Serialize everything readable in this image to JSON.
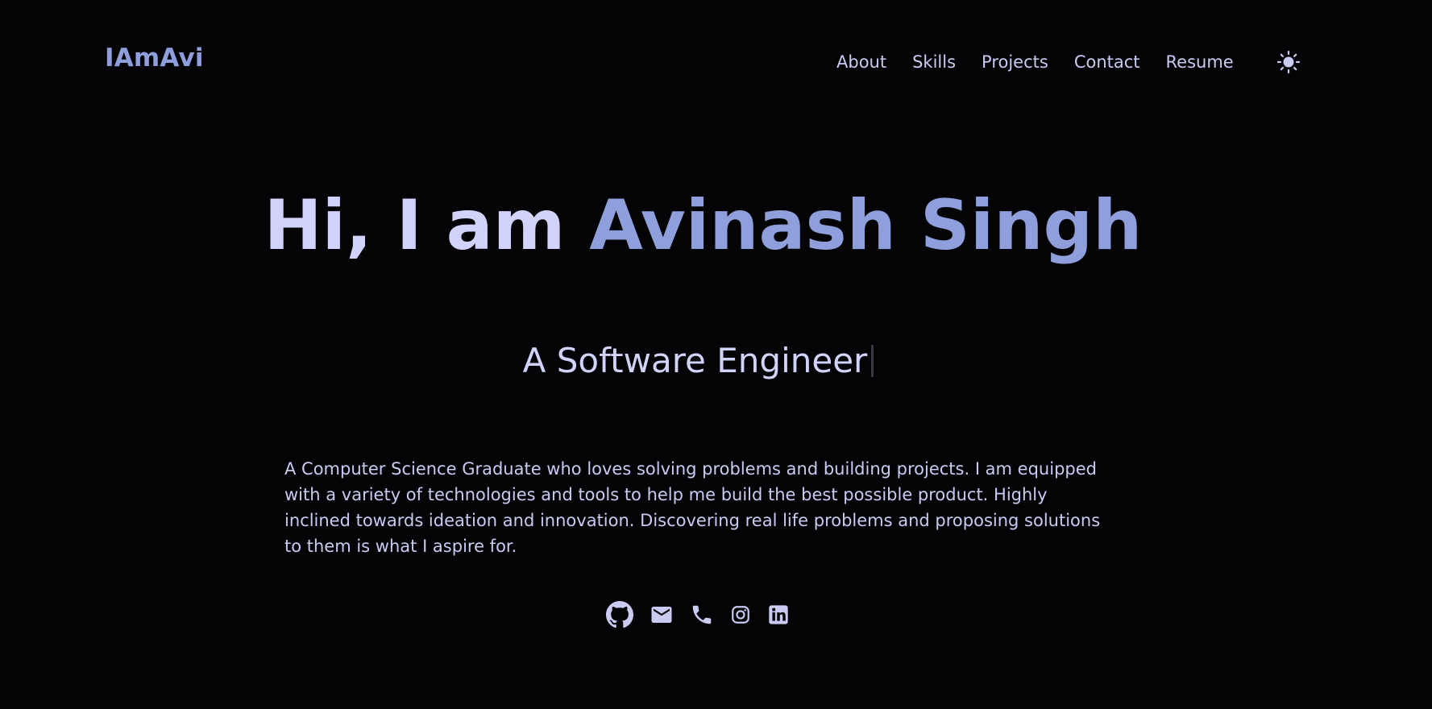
{
  "header": {
    "logo": "IAmAvi",
    "nav": [
      {
        "label": "About"
      },
      {
        "label": "Skills"
      },
      {
        "label": "Projects"
      },
      {
        "label": "Contact"
      },
      {
        "label": "Resume"
      }
    ],
    "theme_toggle_icon": "sun-icon"
  },
  "hero": {
    "greeting": "Hi, I am ",
    "name": "Avinash Singh",
    "subtitle": "A Software Engineer",
    "bio": "A Computer Science Graduate who loves solving problems and building projects. I am equipped with a variety of technologies and tools to help me build the best possible product. Highly inclined towards ideation and innovation. Discovering real life problems and proposing solutions to them is what I aspire for."
  },
  "socials": [
    {
      "icon": "github-icon"
    },
    {
      "icon": "mail-icon"
    },
    {
      "icon": "phone-icon"
    },
    {
      "icon": "instagram-icon"
    },
    {
      "icon": "linkedin-icon"
    }
  ],
  "colors": {
    "background": "#040306",
    "accent": "#8e9fdc",
    "text_light": "#d2d3fb",
    "text": "#c9cbf2"
  }
}
